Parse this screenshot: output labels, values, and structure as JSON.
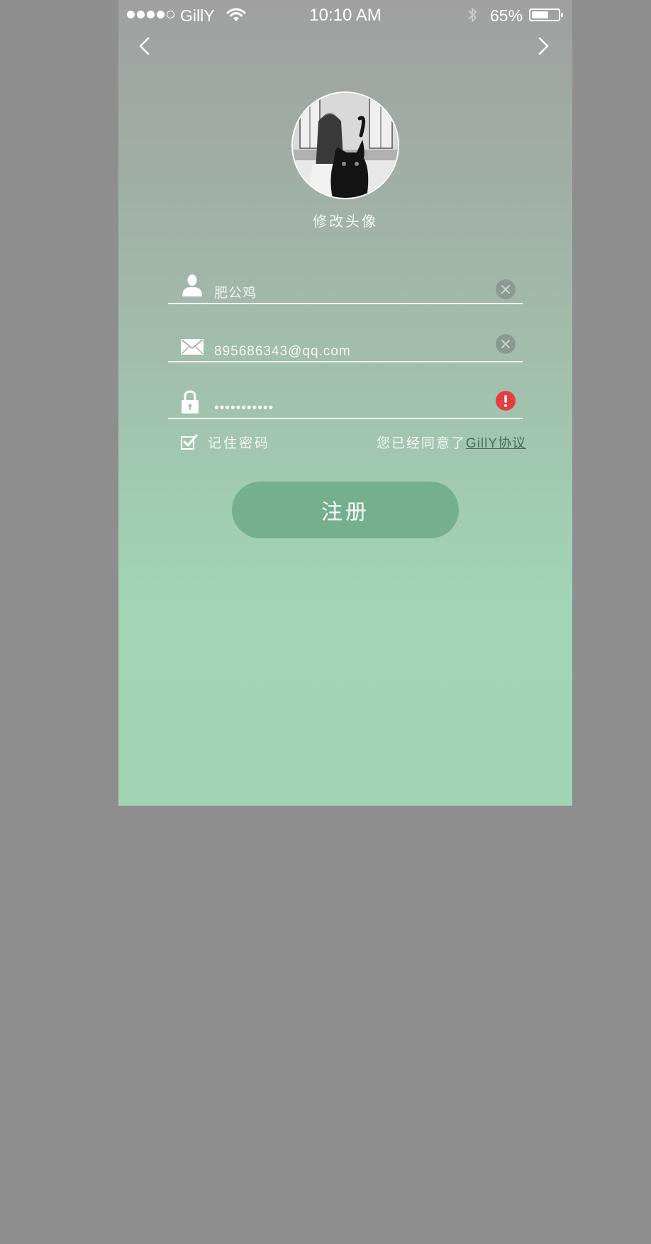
{
  "status_bar": {
    "signal_dots_filled": 4,
    "signal_dots_total": 5,
    "carrier": "GillY",
    "time": "10:10 AM",
    "battery_percent": "65%",
    "battery_level": 0.65
  },
  "nav": {
    "back_icon": "chevron-left-icon",
    "forward_icon": "chevron-right-icon"
  },
  "avatar": {
    "change_label": "修改头像"
  },
  "form": {
    "username": {
      "icon": "user-icon",
      "value": "肥公鸡",
      "action_icon": "clear-icon"
    },
    "email": {
      "icon": "mail-icon",
      "value": "895686343@qq.com",
      "action_icon": "clear-icon"
    },
    "password": {
      "icon": "lock-icon",
      "value": "•••••••••••",
      "action_icon": "error-icon"
    },
    "remember_label": "记住密码",
    "remember_checked": true,
    "agreement_text": "您已经同意了",
    "agreement_link": "GillY协议",
    "submit_label": "注册"
  },
  "colors": {
    "error": "#e53e3e",
    "clear_button": "#8a9a92",
    "primary_button": "#74af8e",
    "link": "#4e6a5a"
  }
}
